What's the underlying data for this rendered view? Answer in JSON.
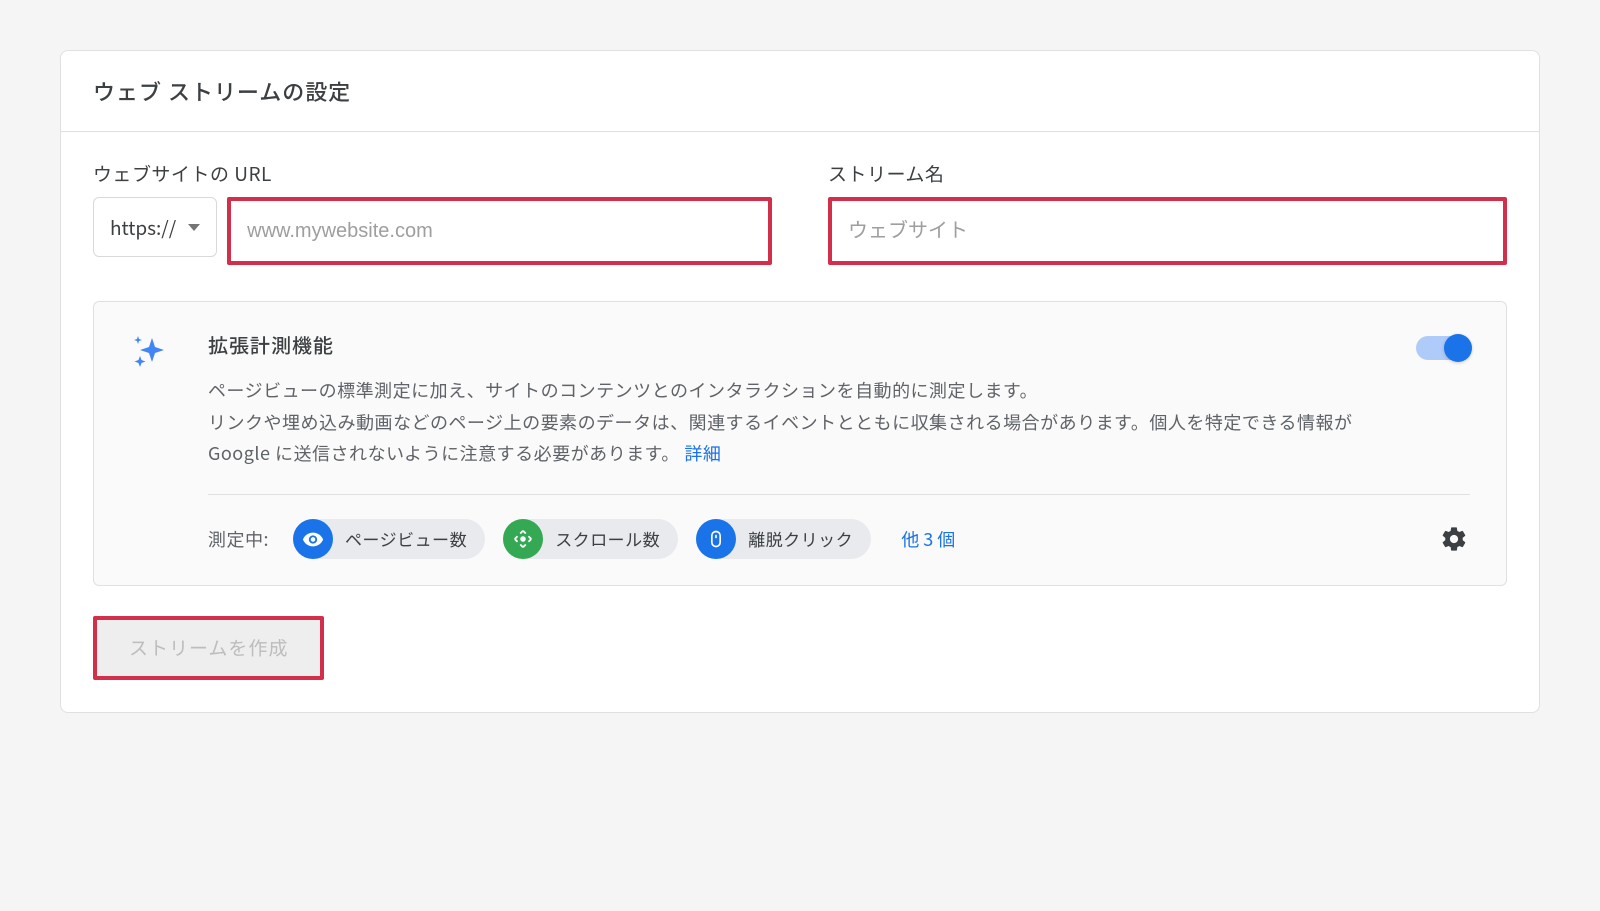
{
  "header": {
    "title": "ウェブ ストリームの設定"
  },
  "form": {
    "url_label": "ウェブサイトの URL",
    "protocol": "https://",
    "url_placeholder": "www.mywebsite.com",
    "name_label": "ストリーム名",
    "name_placeholder": "ウェブサイト"
  },
  "enhanced": {
    "title": "拡張計測機能",
    "desc1": "ページビューの標準測定に加え、サイトのコンテンツとのインタラクションを自動的に測定します。",
    "desc2": "リンクや埋め込み動画などのページ上の要素のデータは、関連するイベントとともに収集される場合があります。個人を特定できる情報が Google に送信されないように注意する必要があります。",
    "details_link": "詳細",
    "measuring_label": "測定中:",
    "chips": {
      "pageviews": "ページビュー数",
      "scrolls": "スクロール数",
      "outbound": "離脱クリック"
    },
    "more": "他 3 個"
  },
  "actions": {
    "create": "ストリームを作成"
  }
}
